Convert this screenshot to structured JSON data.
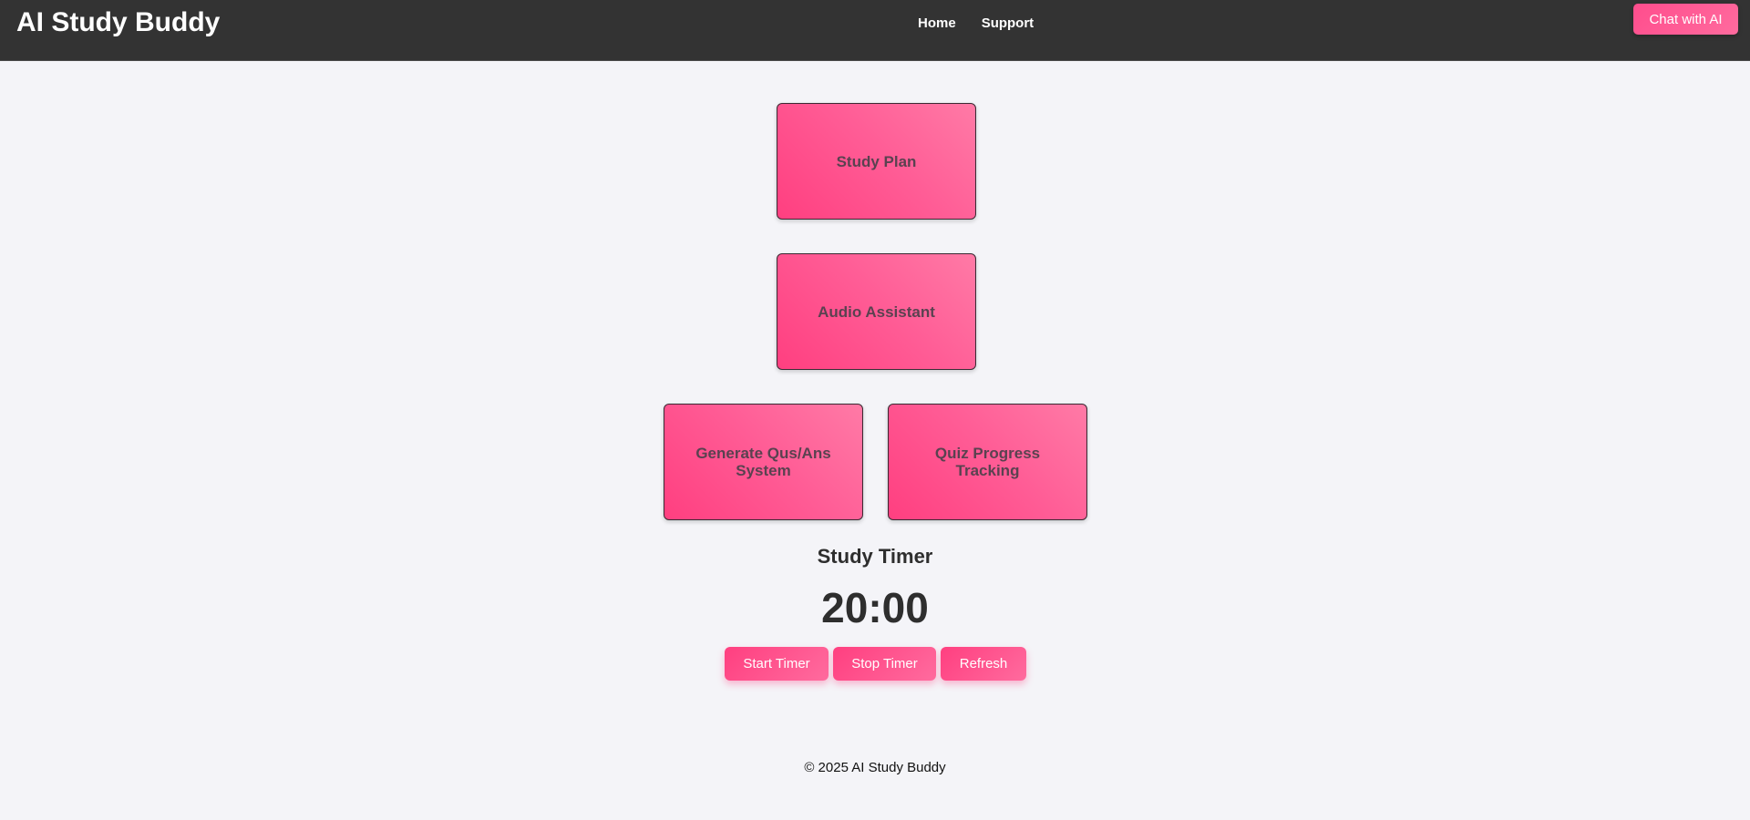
{
  "header": {
    "brand": "AI Study Buddy",
    "nav": [
      {
        "label": "Home"
      },
      {
        "label": "Support"
      }
    ],
    "chat_button": "Chat with AI"
  },
  "features": {
    "study_plan": "Study Plan",
    "audio_assistant": "Audio Assistant",
    "generate_qa": "Generate Qus/Ans System",
    "quiz_progress": "Quiz Progress Tracking"
  },
  "timer": {
    "heading": "Study Timer",
    "value": "20:00",
    "start_label": "Start Timer",
    "stop_label": "Stop Timer",
    "refresh_label": "Refresh"
  },
  "footer": {
    "text": "© 2025 AI Study Buddy"
  },
  "colors": {
    "header_bg": "#333333",
    "accent": "#ff4d8d",
    "page_bg": "#f4f4f8"
  }
}
